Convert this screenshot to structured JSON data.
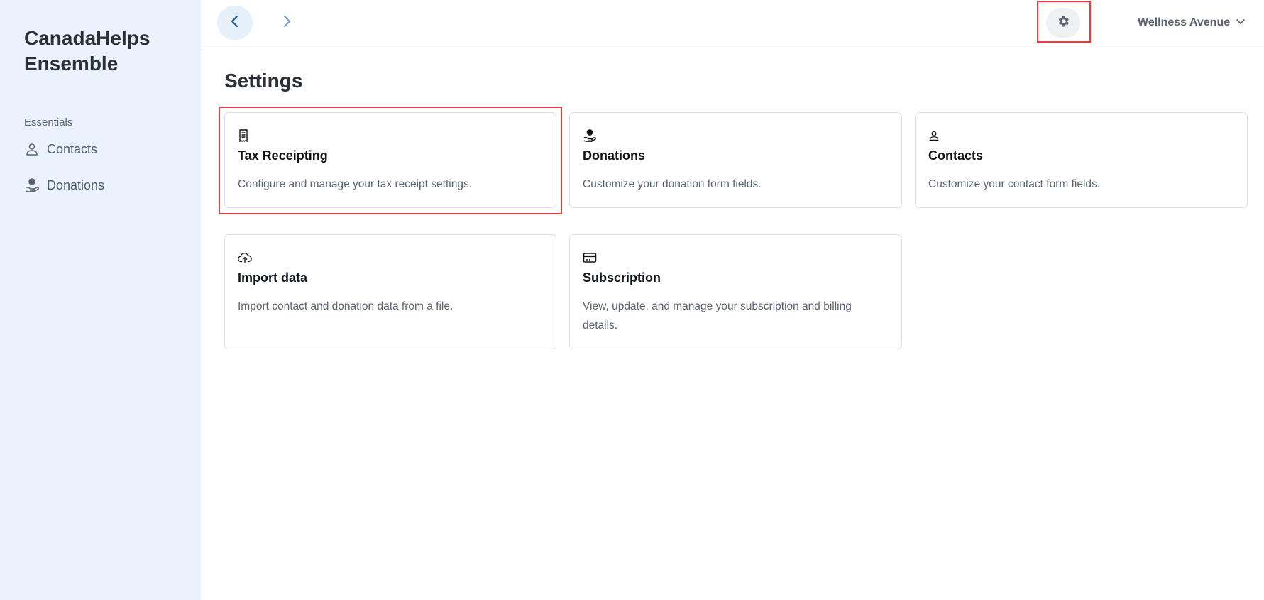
{
  "sidebar": {
    "brand": "CanadaHelps\nEnsemble",
    "section_label": "Essentials",
    "items": [
      {
        "label": "Contacts",
        "icon": "person-icon"
      },
      {
        "label": "Donations",
        "icon": "donation-hand-icon"
      }
    ]
  },
  "topbar": {
    "back_icon": "chevron-left-icon",
    "forward_icon": "chevron-right-icon",
    "settings_icon": "gear-icon",
    "org_name": "Wellness Avenue",
    "org_dropdown_icon": "chevron-down-icon"
  },
  "page": {
    "title": "Settings"
  },
  "cards": [
    {
      "title": "Tax Receipting",
      "description": "Configure and manage your tax receipt settings.",
      "icon": "receipt-icon"
    },
    {
      "title": "Donations",
      "description": "Customize your donation form fields.",
      "icon": "donation-hand-icon"
    },
    {
      "title": "Contacts",
      "description": "Customize your contact form fields.",
      "icon": "person-icon"
    },
    {
      "title": "Import data",
      "description": "Import contact and donation data from a file.",
      "icon": "cloud-upload-icon"
    },
    {
      "title": "Subscription",
      "description": "View, update, and manage your subscription and billing details.",
      "icon": "credit-card-icon"
    }
  ],
  "colors": {
    "sidebar_bg": "#eaf3fb",
    "highlight": "#e53e3e",
    "accent_blue": "#1f5f99"
  }
}
